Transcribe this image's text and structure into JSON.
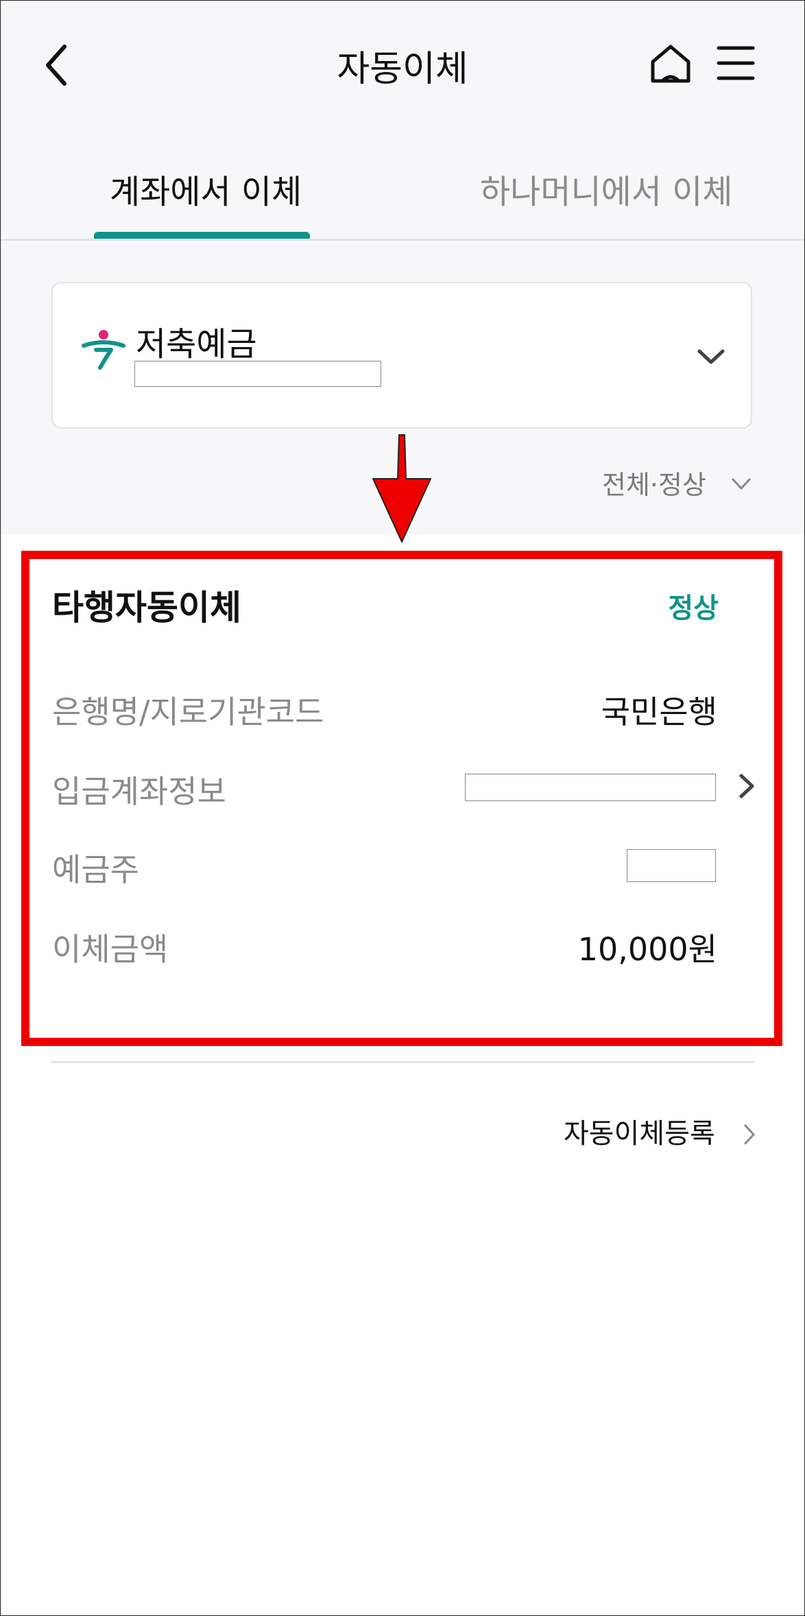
{
  "header": {
    "title": "자동이체",
    "back_icon": "chevron-left-icon",
    "home_icon": "home-icon",
    "menu_icon": "hamburger-menu-icon"
  },
  "tabs": [
    {
      "label": "계좌에서 이체",
      "active": true
    },
    {
      "label": "하나머니에서 이체",
      "active": false
    }
  ],
  "accent_color": "#0f9488",
  "account_selector": {
    "name": "저축예금",
    "number": "",
    "logo_icon": "hana-bank-logo-icon"
  },
  "filter": {
    "label": "전체·정상"
  },
  "transfer_card": {
    "title": "타행자동이체",
    "status": "정상",
    "rows": [
      {
        "label": "은행명/지로기관코드",
        "value": "국민은행"
      },
      {
        "label": "입금계좌정보",
        "value": ""
      },
      {
        "label": "예금주",
        "value": ""
      },
      {
        "label": "이체금액",
        "value": "10,000원"
      }
    ]
  },
  "register_link": {
    "label": "자동이체등록"
  }
}
